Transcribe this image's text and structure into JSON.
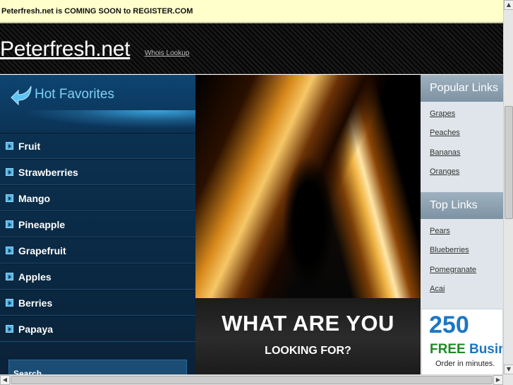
{
  "notice": {
    "text": "Peterfresh.net is COMING SOON to REGISTER.COM"
  },
  "header": {
    "site_title": "Peterfresh.net",
    "whois_link": "Whois Lookup"
  },
  "hot_favorites": {
    "title": "Hot Favorites",
    "items": [
      {
        "label": "Fruit"
      },
      {
        "label": "Strawberries"
      },
      {
        "label": "Mango"
      },
      {
        "label": "Pineapple"
      },
      {
        "label": "Grapefruit"
      },
      {
        "label": "Apples"
      },
      {
        "label": "Berries"
      },
      {
        "label": "Papaya"
      }
    ],
    "search_label": "Search"
  },
  "hero": {
    "title": "WHAT ARE YOU",
    "subtitle": "LOOKING FOR?"
  },
  "popular_links": {
    "title": "Popular Links",
    "items": [
      {
        "label": "Grapes"
      },
      {
        "label": "Peaches"
      },
      {
        "label": "Bananas"
      },
      {
        "label": "Oranges"
      }
    ]
  },
  "top_links": {
    "title": "Top Links",
    "items": [
      {
        "label": "Pears"
      },
      {
        "label": "Blueberries"
      },
      {
        "label": "Pomegranate"
      },
      {
        "label": "Acai"
      }
    ]
  },
  "ad": {
    "number": "250",
    "free_word": "FREE",
    "rest_word": "Busine",
    "order_text": "Order in minutes."
  },
  "colors": {
    "menu_bg": "#0c3556",
    "accent_blue": "#4fb4e6",
    "notice_bg": "#ffffcc",
    "sidebar_head": "#8ea2b2"
  }
}
